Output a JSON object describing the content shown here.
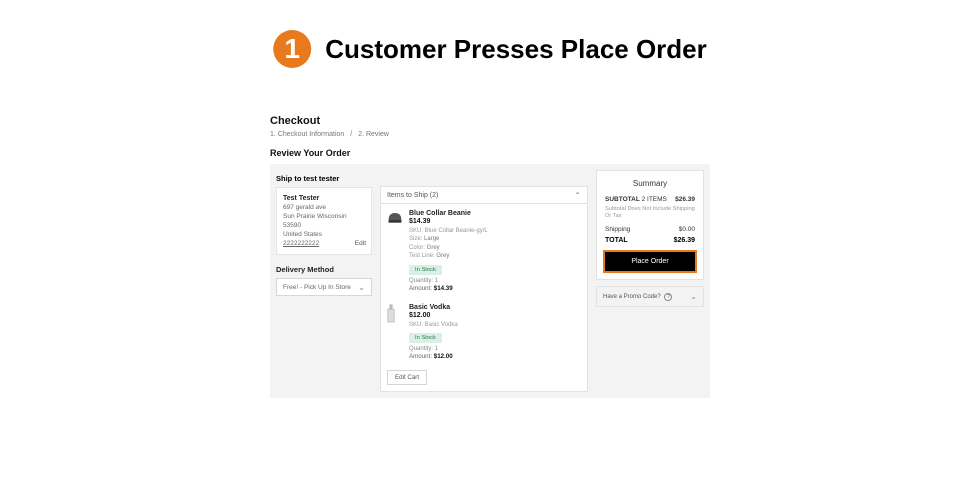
{
  "step": {
    "number": "1",
    "title": "Customer Presses Place Order"
  },
  "checkout": {
    "title": "Checkout",
    "breadcrumb_step1": "1. Checkout Information",
    "breadcrumb_sep": "/",
    "breadcrumb_step2": "2. Review",
    "review_heading": "Review Your Order",
    "ship_to_label": "Ship to test tester",
    "address": {
      "name": "Test Tester",
      "line1": "697 gerald ave",
      "line2": "Sun Prairie Wisconsin 53590",
      "country": "United States",
      "phone": "2222222222",
      "edit_label": "Edit"
    },
    "delivery": {
      "label": "Delivery Method",
      "selected": "Free! - Pick Up In Store"
    },
    "items_header": "Items to Ship (2)",
    "items": [
      {
        "title": "Blue Collar Beanie",
        "price": "$14.39",
        "sku": "SKU: Blue Collar Beanie-gy/L",
        "size_label": "Size:",
        "size_value": "Large",
        "color_label": "Color:",
        "color_value": "Grey",
        "line_label": "Test Line:",
        "line_value": "Grey",
        "stock": "In Stock",
        "qty_label": "Quantity:",
        "qty_value": "1",
        "amount_label": "Amount:",
        "amount_value": "$14.39",
        "kind": "beanie"
      },
      {
        "title": "Basic Vodka",
        "price": "$12.00",
        "sku": "SKU: Basic Vodka",
        "stock": "In Stock",
        "qty_label": "Quantity:",
        "qty_value": "1",
        "amount_label": "Amount:",
        "amount_value": "$12.00",
        "kind": "bottle"
      }
    ],
    "edit_cart_label": "Edit Cart",
    "summary": {
      "title": "Summary",
      "subtotal_label": "SUBTOTAL",
      "subtotal_items": "2 ITEMS",
      "subtotal_value": "$26.39",
      "note": "Subtotal Does Not Include Shipping Or Tax",
      "shipping_label": "Shipping",
      "shipping_value": "$0.00",
      "total_label": "TOTAL",
      "total_value": "$26.39",
      "place_order_label": "Place Order",
      "promo_label": "Have a Promo Code?"
    }
  }
}
